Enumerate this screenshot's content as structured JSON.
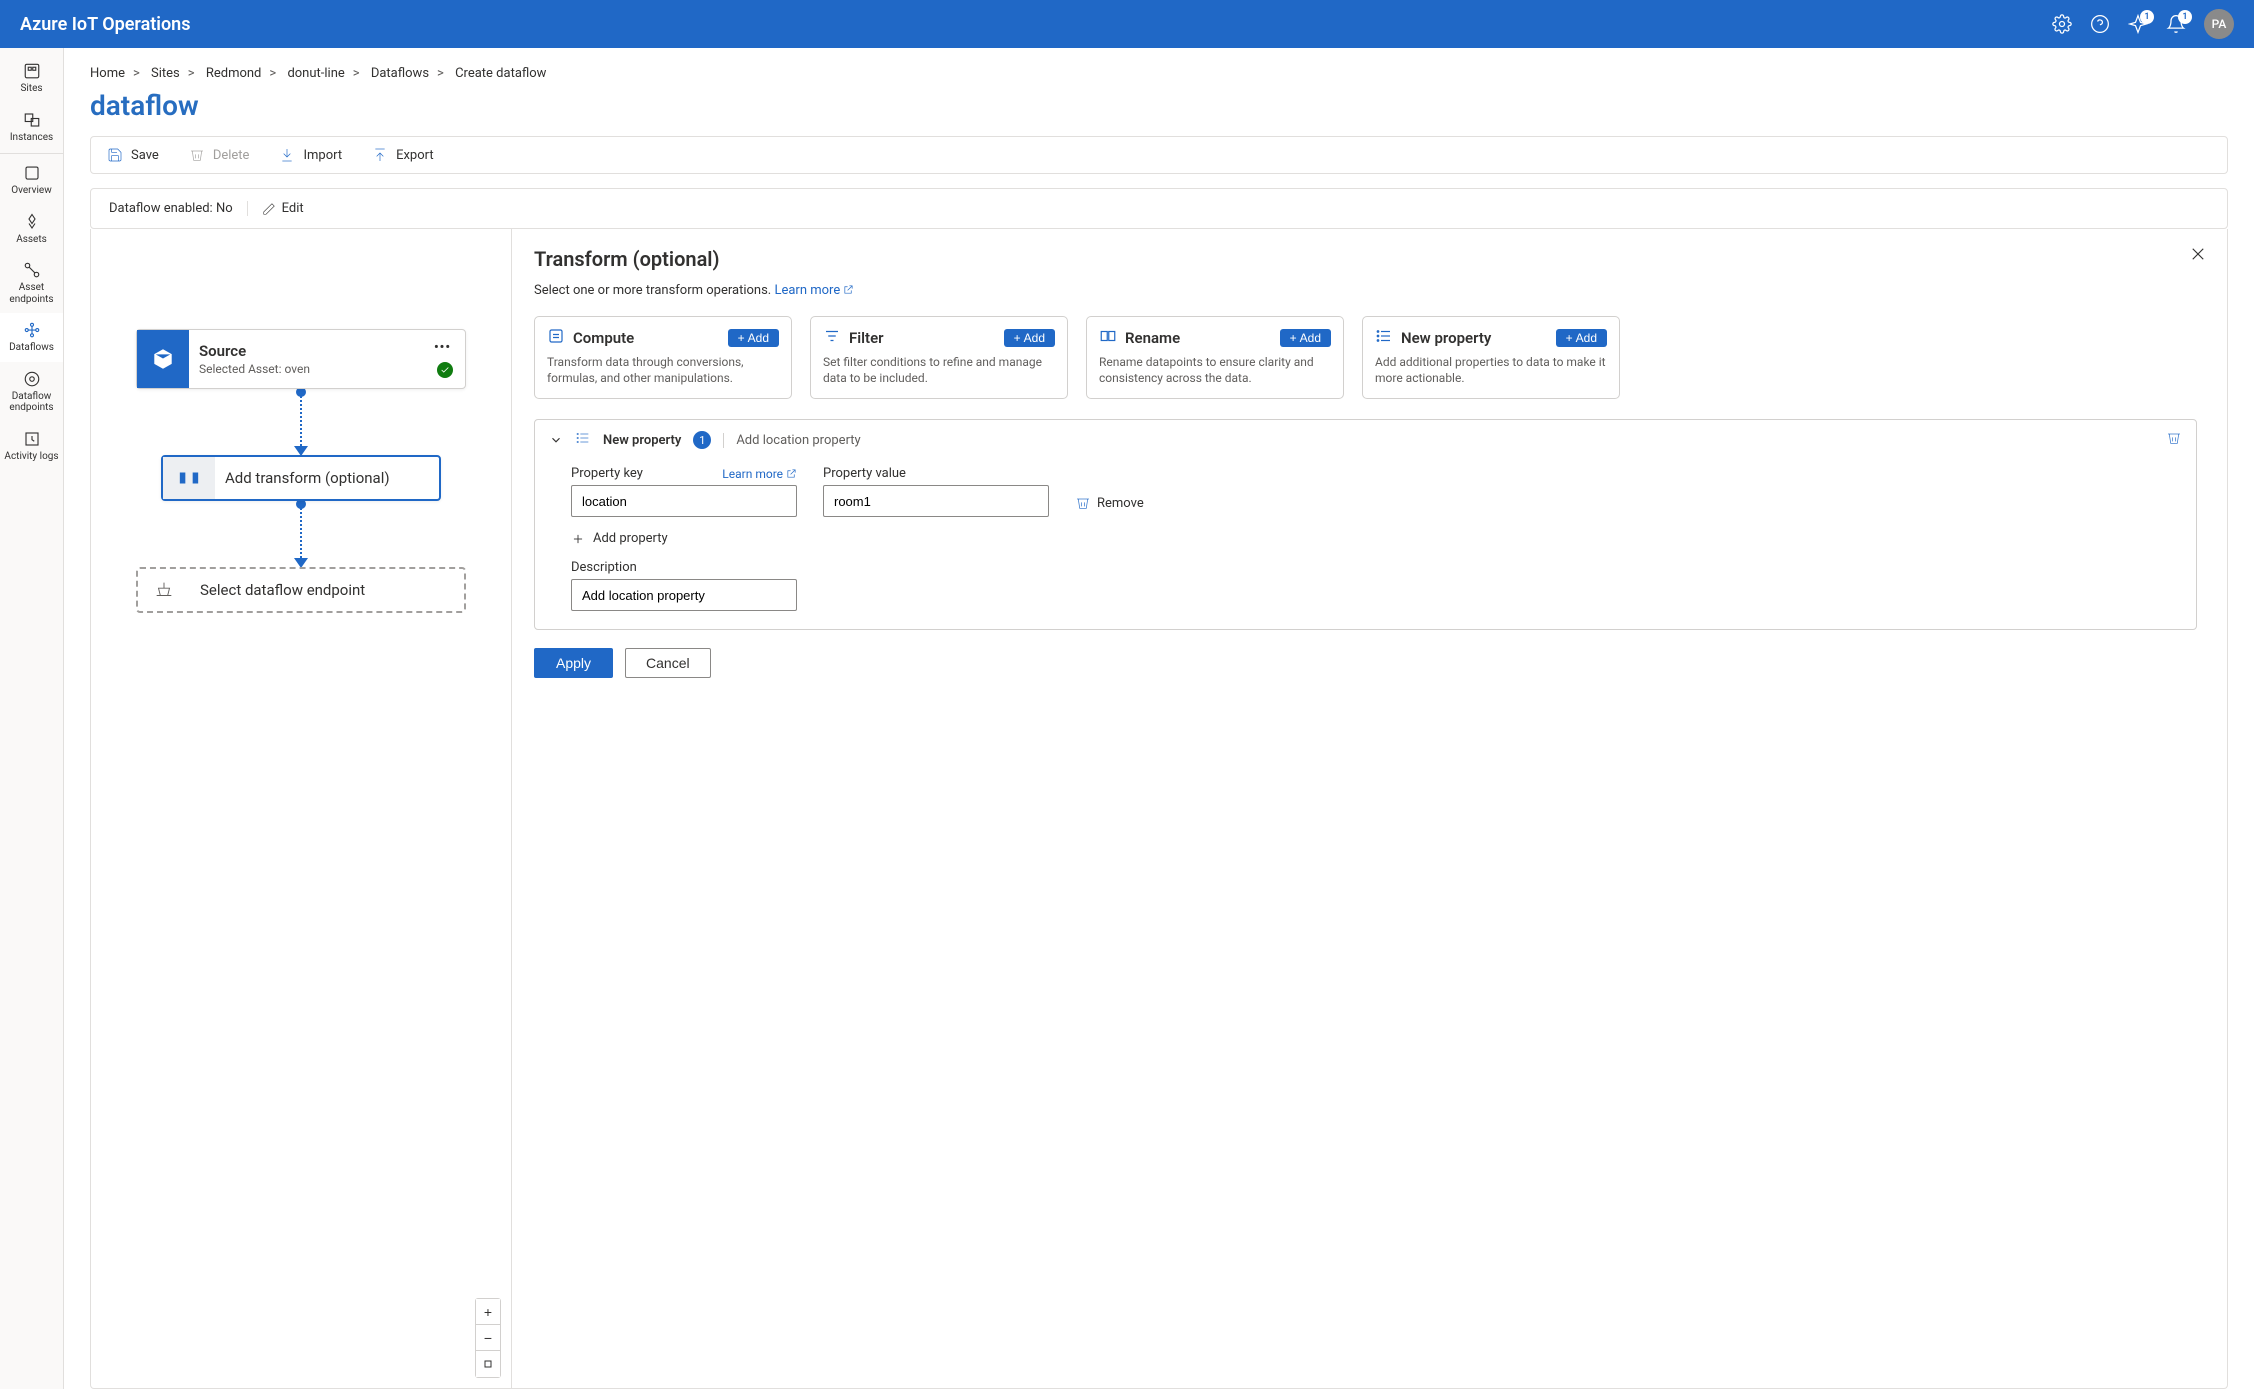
{
  "header": {
    "product": "Azure IoT Operations",
    "badge1": "1",
    "badge2": "1",
    "avatar": "PA"
  },
  "nav": {
    "sites": "Sites",
    "instances": "Instances",
    "overview": "Overview",
    "assets": "Assets",
    "asset_endpoints": "Asset endpoints",
    "dataflows": "Dataflows",
    "dataflow_endpoints": "Dataflow endpoints",
    "activity_logs": "Activity logs"
  },
  "breadcrumb": {
    "items": [
      "Home",
      "Sites",
      "Redmond",
      "donut-line",
      "Dataflows"
    ],
    "current": "Create dataflow"
  },
  "page_title": "dataflow",
  "commands": {
    "save": "Save",
    "delete": "Delete",
    "import": "Import",
    "export": "Export"
  },
  "enable": {
    "label": "Dataflow enabled:",
    "value": "No",
    "edit": "Edit"
  },
  "canvas": {
    "source": {
      "title": "Source",
      "subtitle": "Selected Asset: oven"
    },
    "transform": {
      "title": "Add transform (optional)"
    },
    "dest": {
      "title": "Select dataflow endpoint"
    }
  },
  "panel": {
    "title": "Transform (optional)",
    "sub": "Select one or more transform operations.",
    "learn_more": "Learn more",
    "ops": {
      "compute": {
        "title": "Compute",
        "add": "Add",
        "desc": "Transform data through conversions, formulas, and other manipulations."
      },
      "filter": {
        "title": "Filter",
        "add": "Add",
        "desc": "Set filter conditions to refine and manage data to be included."
      },
      "rename": {
        "title": "Rename",
        "add": "Add",
        "desc": "Rename datapoints to ensure clarity and consistency across the data."
      },
      "newprop": {
        "title": "New property",
        "add": "Add",
        "desc": "Add additional properties to data to make it more actionable."
      }
    },
    "expanded": {
      "title": "New property",
      "count": "1",
      "desc": "Add location property",
      "fields": {
        "key_lbl": "Property key",
        "val_lbl": "Property value",
        "key": "location",
        "val": "room1",
        "learn_more": "Learn more",
        "remove": "Remove",
        "add_property": "Add property",
        "desc_lbl": "Description",
        "desc_val": "Add location property"
      }
    },
    "apply": "Apply",
    "cancel": "Cancel"
  }
}
